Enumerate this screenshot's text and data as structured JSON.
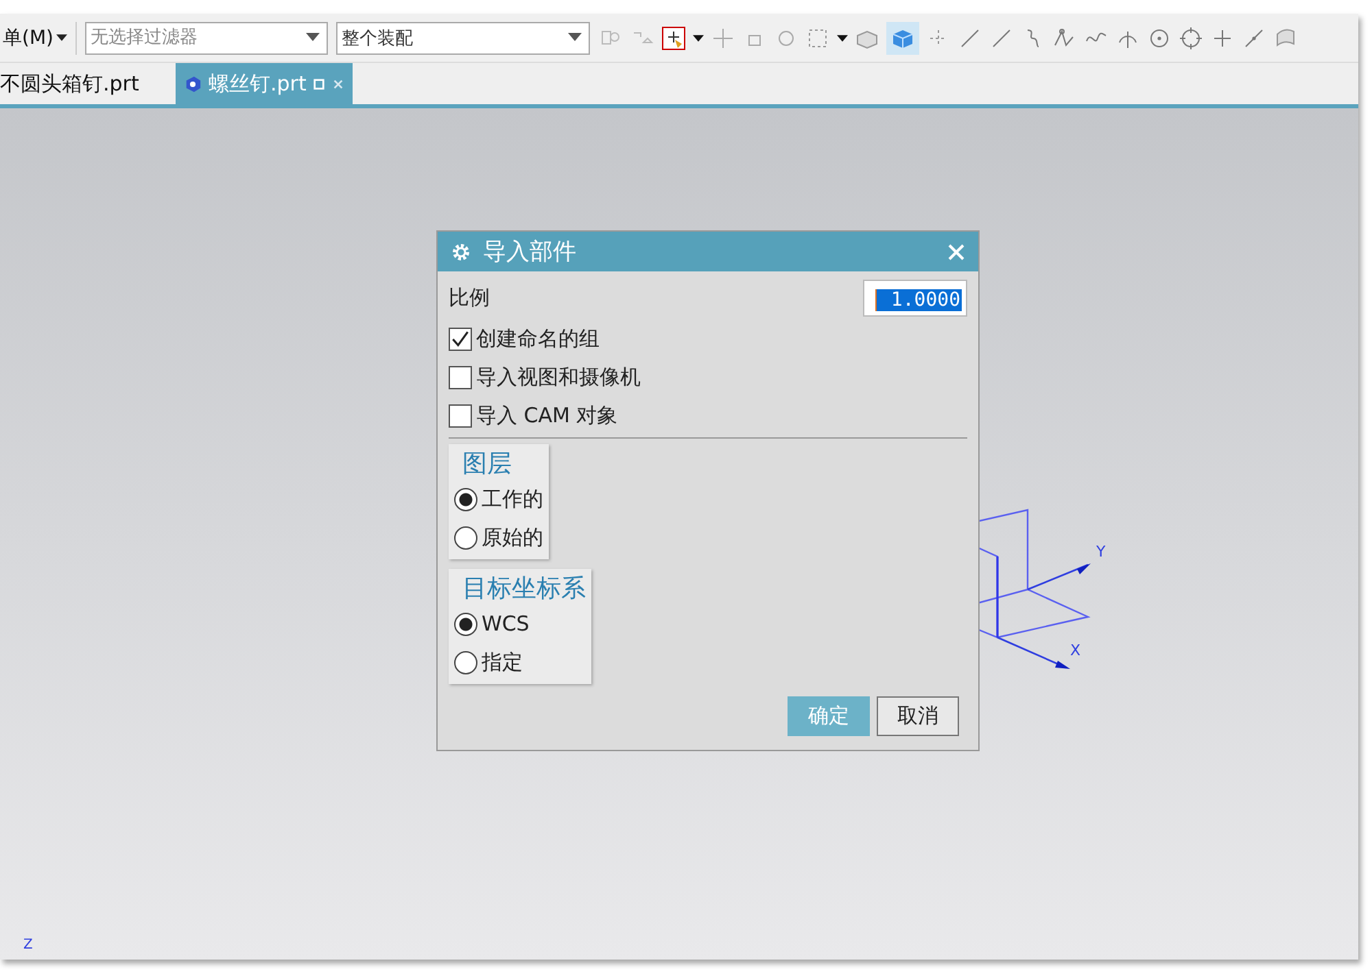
{
  "toolbar": {
    "menu": "单(M)",
    "selection_filter": {
      "placeholder": "无选择过滤器"
    },
    "scope": {
      "value": "整个装配"
    }
  },
  "tabs": [
    {
      "label": "不圆头箱钉.prt",
      "selected": false
    },
    {
      "label": "螺丝钉.prt",
      "selected": true
    }
  ],
  "dialog": {
    "title": "导入部件",
    "scale": {
      "label": "比例",
      "value": "1.0000"
    },
    "options": [
      {
        "label": "创建命名的组",
        "checked": true
      },
      {
        "label": "导入视图和摄像机",
        "checked": false
      },
      {
        "label": "导入 CAM 对象",
        "checked": false
      }
    ],
    "groups": [
      {
        "title": "图层",
        "choices": [
          {
            "label": "工作的",
            "selected": true
          },
          {
            "label": "原始的",
            "selected": false
          }
        ]
      },
      {
        "title": "目标坐标系",
        "choices": [
          {
            "label": "WCS",
            "selected": true
          },
          {
            "label": "指定",
            "selected": false
          }
        ]
      }
    ],
    "buttons": [
      {
        "label": "确定",
        "kind": "primary"
      },
      {
        "label": "取消",
        "kind": "secondary"
      }
    ]
  },
  "triad": {
    "y_label": "Y",
    "x_label": "X",
    "z_label": "Z"
  }
}
